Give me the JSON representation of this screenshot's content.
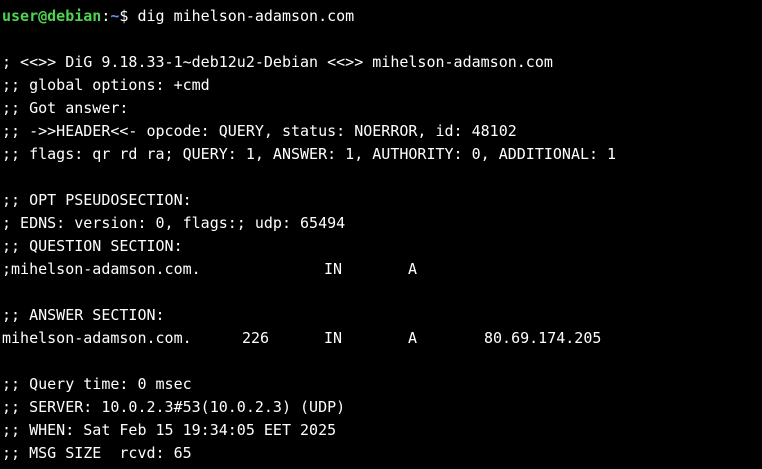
{
  "colors": {
    "background": "#000000",
    "text": "#ffffff",
    "prompt_user": "#4fd44f",
    "prompt_path": "#6a8cf0"
  },
  "prompt": {
    "user_host": "user@debian",
    "sep": ":",
    "path": "~",
    "symbol": "$ ",
    "command": "dig mihelson-adamson.com"
  },
  "output": {
    "header_banner": "; <<>> DiG 9.18.33-1~deb12u2-Debian <<>> mihelson-adamson.com",
    "global_options": ";; global options: +cmd",
    "got_answer": ";; Got answer:",
    "header_line": ";; ->>HEADER<<- opcode: QUERY, status: NOERROR, id: 48102",
    "flags_line": ";; flags: qr rd ra; QUERY: 1, ANSWER: 1, AUTHORITY: 0, ADDITIONAL: 1",
    "opt_section": ";; OPT PSEUDOSECTION:",
    "edns_line": "; EDNS: version: 0, flags:; udp: 65494",
    "question_section": ";; QUESTION SECTION:",
    "question": {
      "name": ";mihelson-adamson.com.",
      "class": "IN",
      "type": "A"
    },
    "answer_section": ";; ANSWER SECTION:",
    "answer": {
      "name": "mihelson-adamson.com.",
      "ttl": "226",
      "class": "IN",
      "type": "A",
      "address": "80.69.174.205"
    },
    "query_time": ";; Query time: 0 msec",
    "server": ";; SERVER: 10.0.2.3#53(10.0.2.3) (UDP)",
    "when": ";; WHEN: Sat Feb 15 19:34:05 EET 2025",
    "msg_size": ";; MSG SIZE  rcvd: 65"
  }
}
